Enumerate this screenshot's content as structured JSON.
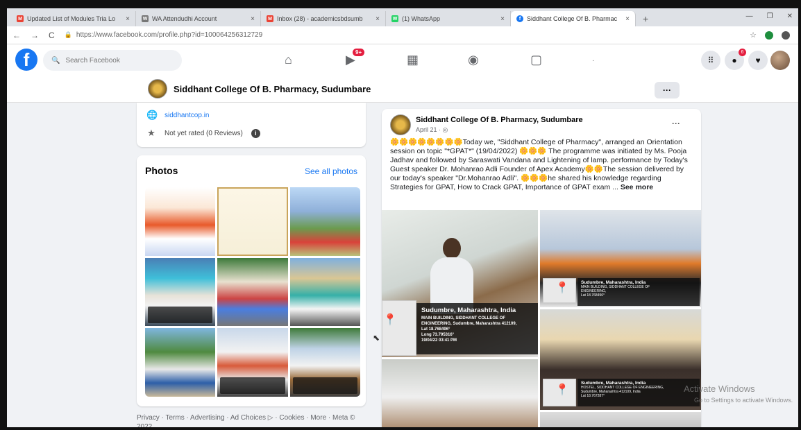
{
  "browser": {
    "tabs": [
      {
        "label": "Updated List of Modules Tria Lo",
        "fav_color": "#ea4335",
        "fav": "M"
      },
      {
        "label": "WA  Attendudhi Account",
        "fav_color": "#777777",
        "fav": "W"
      },
      {
        "label": "Inbox (28) - academicsbdsumb",
        "fav_color": "#ea4335",
        "fav": "M"
      },
      {
        "label": "(1) WhatsApp",
        "fav_color": "#25d366",
        "fav": "W"
      },
      {
        "label": "Siddhant College Of B. Pharmac",
        "fav_color": "#1877f2",
        "fav": "f"
      }
    ],
    "url": "https://www.facebook.com/profile.php?id=100064256312729"
  },
  "fbnav": {
    "search_placeholder": "Search Facebook",
    "watch_badge": "9+",
    "notif_badge": "6"
  },
  "page": {
    "name": "Siddhant College Of B. Pharmacy, Sudumbare",
    "more_label": "···"
  },
  "intro": {
    "website": "siddhantcop.in",
    "rating": "Not yet rated (0 Reviews)",
    "info_icon": "i"
  },
  "photos": {
    "title": "Photos",
    "see_all": "See all photos"
  },
  "footer": {
    "text": "Privacy · Terms · Advertising · Ad Choices ▷ · Cookies · More · Meta © 2022"
  },
  "post": {
    "author": "Siddhant College Of B. Pharmacy, Sudumbare",
    "date": "April 21 · ◎",
    "more": "···",
    "text": "🌼🌼🌼🌼🌼🌼🌼🌼Today we, \"Siddhant College of Pharmacy\", arranged an Orientation session on topic \"*GPAT*\" (19/04/2022) 🌼🌼🌼 The programme was initiated by Ms. Pooja Jadhav and followed by Saraswati Vandana and Lightening of lamp. performance by Today's Guest speaker Dr. Mohanrao Adli Founder of Apex Academy🌼🌼The session delivered by our today's speaker \"Dr.Mohanrao Adli\". 🌼🌼🌼he shared his knowledge regarding Strategies for GPAT, How to Crack GPAT, Importance of GPAT exam ... ",
    "see_more": "See more",
    "geotag_main": {
      "title": "Sudumbre, Maharashtra, India",
      "l1": "MAIN BUILDING, SIDDHANT COLLEGE OF",
      "l2": "ENGINEERING, Sudumbre, Maharashtra 412109,",
      "l3": "Lat 18.768496°",
      "l4": "Long 73.795316°",
      "l5": "19/04/22 03:41 PM"
    },
    "geotag_b": {
      "title": "Sudumbre, Maharashtra, India",
      "l1": "MAIN BUILDING, SIDDHANT COLLEGE OF",
      "l2": "ENGINEERING,",
      "l3": "Lat 18.768496°"
    },
    "geotag_c": {
      "title": "Sudumbre, Maharashtra, India",
      "l1": "HOSTEL, SIDDHANT COLLEGE OF ENGINEERING,",
      "l2": "Sudumbre, Maharashtra 412109, India",
      "l3": "Lat 18.767287°"
    }
  },
  "watermark": {
    "line1": "Activate Windows",
    "line2": "Go to Settings to activate Windows."
  }
}
